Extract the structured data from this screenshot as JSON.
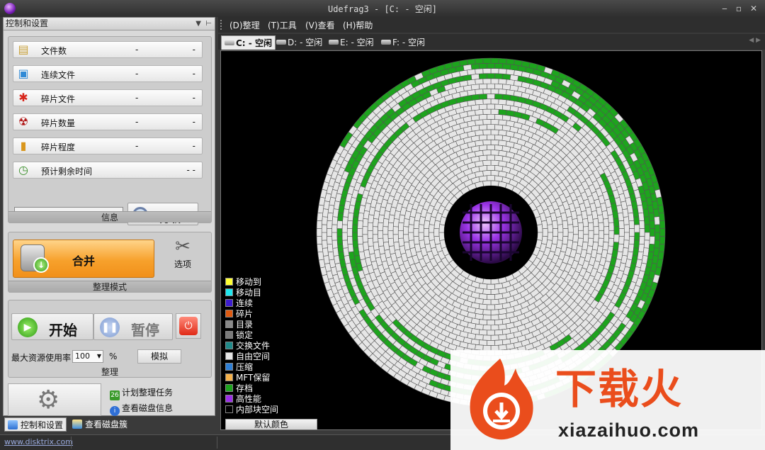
{
  "window": {
    "title": "Udefrag3 - [C: - 空闲]"
  },
  "left_panel": {
    "header": "控制和设置",
    "info_rows": [
      {
        "label": "文件数",
        "v1": "-",
        "v2": "-",
        "icon": "files-icon"
      },
      {
        "label": "连续文件",
        "v1": "-",
        "v2": "-",
        "icon": "contiguous-files-icon"
      },
      {
        "label": "碎片文件",
        "v1": "-",
        "v2": "-",
        "icon": "fragmented-files-icon"
      },
      {
        "label": "碎片数量",
        "v1": "-",
        "v2": "-",
        "icon": "fragment-count-icon"
      },
      {
        "label": "碎片程度",
        "v1": "-",
        "v2": "-",
        "icon": "fragmentation-level-icon"
      },
      {
        "label": "预计剩余时间",
        "v1": "",
        "v2": "- -",
        "icon": "time-remaining-icon"
      }
    ],
    "analyze_label": "分析",
    "info_caption": "信息",
    "merge_label": "合并",
    "options_label": "选项",
    "mode_caption": "整理模式",
    "start_label": "开始",
    "pause_label": "暂停",
    "max_resource_label": "最大资源使用率",
    "max_resource_value": "100",
    "percent_sign": "%",
    "simulate_label": "模拟",
    "defrag_caption": "整理",
    "schedule_link": "计划整理任务",
    "view_disk_info_link": "查看磁盘信息",
    "bottom_tabs": [
      "控制和设置",
      "查看磁盘簇"
    ]
  },
  "menu": [
    "(D)整理",
    "(T)工具",
    "(V)查看",
    "(H)帮助"
  ],
  "drive_tabs": [
    "C: - 空闲",
    "D: - 空闲",
    "E: - 空闲",
    "F: - 空闲"
  ],
  "legend": [
    {
      "label": "移动到",
      "color": "#ffff33"
    },
    {
      "label": "移动目",
      "color": "#20e8f0"
    },
    {
      "label": "连续",
      "color": "#3d1ccf"
    },
    {
      "label": "碎片",
      "color": "#e05a10"
    },
    {
      "label": "目录",
      "color": "#8a8a8a"
    },
    {
      "label": "锁定",
      "color": "#7a7a7a"
    },
    {
      "label": "交换文件",
      "color": "#1f8a8a"
    },
    {
      "label": "自由空间",
      "color": "#e6e6e6"
    },
    {
      "label": "压缩",
      "color": "#2e7fd6"
    },
    {
      "label": "MFT保留",
      "color": "#f5b14a"
    },
    {
      "label": "存档",
      "color": "#1da41d"
    },
    {
      "label": "高性能",
      "color": "#9b2ee8"
    },
    {
      "label": "内部块空间",
      "color": "#000000"
    }
  ],
  "default_colors_label": "默认颜色",
  "status_bar": {
    "website": "www.disktrix.com"
  },
  "watermark": {
    "cn": "下载火",
    "en": "xiazaihuo.com"
  },
  "colors": {
    "free": "#e6e6e6",
    "used": "#1da41d",
    "accent": "#f7a12c"
  }
}
